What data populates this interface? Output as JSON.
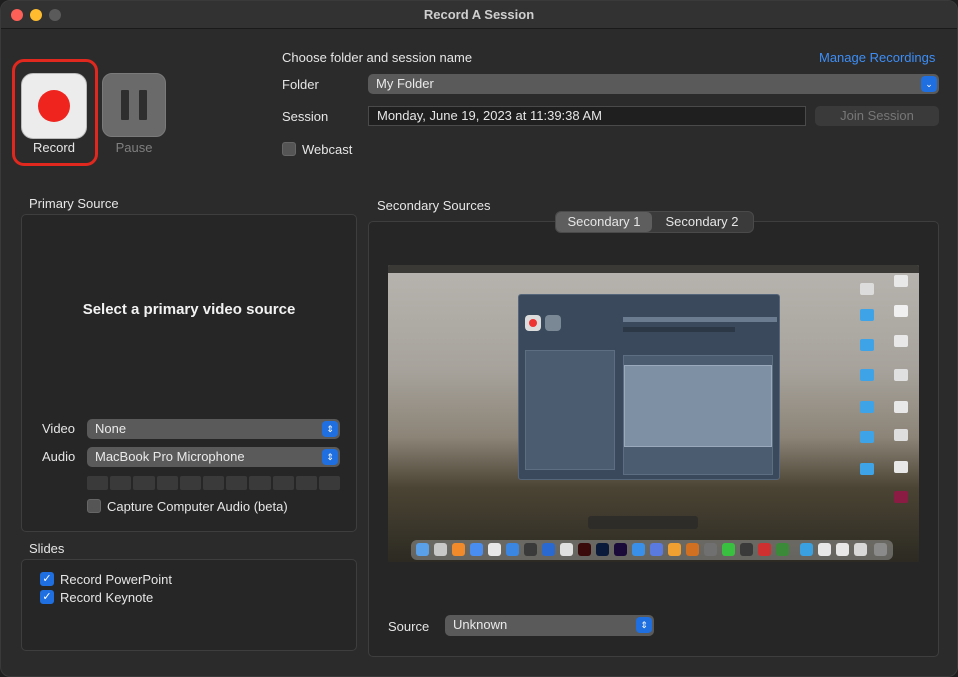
{
  "window": {
    "title": "Record A Session"
  },
  "record": {
    "record_label": "Record",
    "pause_label": "Pause"
  },
  "session": {
    "heading": "Choose folder and session name",
    "manage_link": "Manage Recordings",
    "folder_label": "Folder",
    "folder_value": "My Folder",
    "session_label": "Session",
    "session_value": "Monday, June 19, 2023 at 11:39:38 AM",
    "join_label": "Join Session",
    "webcast_label": "Webcast",
    "webcast_checked": false
  },
  "primary": {
    "heading": "Primary Source",
    "placeholder": "Select a primary video source",
    "video_label": "Video",
    "video_value": "None",
    "audio_label": "Audio",
    "audio_value": "MacBook Pro Microphone",
    "capture_label": "Capture Computer Audio (beta)",
    "capture_checked": false
  },
  "slides": {
    "heading": "Slides",
    "items": [
      {
        "label": "Record PowerPoint",
        "checked": true
      },
      {
        "label": "Record Keynote",
        "checked": true
      }
    ]
  },
  "secondary": {
    "heading": "Secondary Sources",
    "tabs": [
      {
        "label": "Secondary 1",
        "selected": true
      },
      {
        "label": "Secondary 2",
        "selected": false
      }
    ],
    "source_label": "Source",
    "source_value": "Unknown"
  },
  "colors": {
    "record_red": "#f0241e",
    "highlight_red": "#e0281e",
    "accent_blue": "#1f6fe0",
    "link_blue": "#3d8ef6"
  },
  "icons": {
    "record": "record-icon",
    "pause": "pause-icon",
    "select_arrows": "chevron-up-down-icon",
    "checkmark": "checkmark-icon"
  }
}
